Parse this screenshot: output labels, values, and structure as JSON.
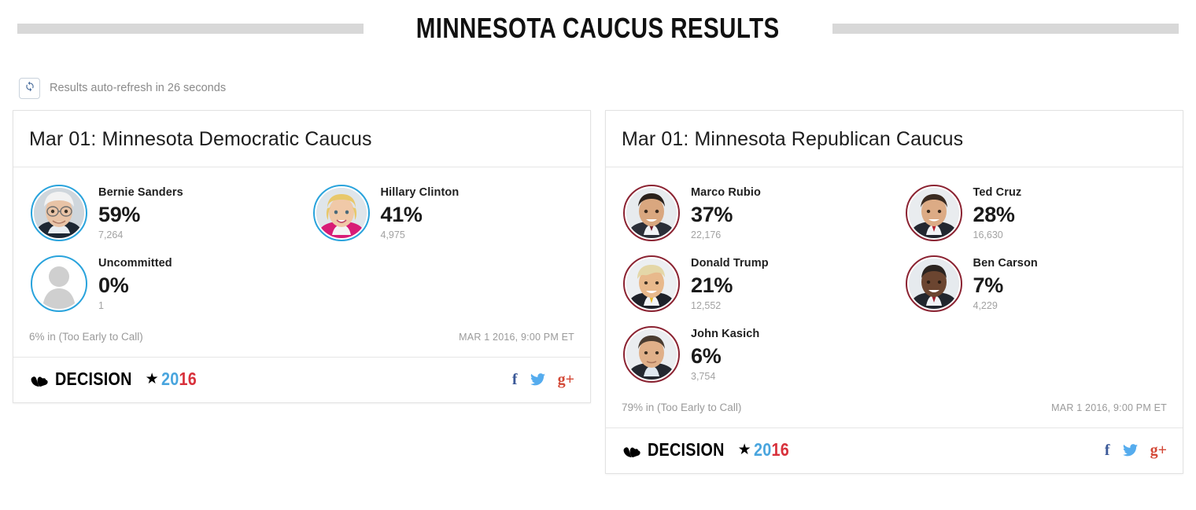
{
  "page": {
    "title": "MINNESOTA CAUCUS RESULTS"
  },
  "refresh": {
    "icon": "refresh-icon",
    "note": "Results auto-refresh in 26 seconds"
  },
  "colors": {
    "democratic_ring": "#29a3dc",
    "republican_ring": "#8b2332",
    "logo_blue": "#49a5de",
    "logo_red": "#d8313b",
    "facebook": "#3b5998",
    "twitter": "#55acee",
    "googleplus": "#d34836"
  },
  "logo": {
    "word": "DECISION",
    "star": "★",
    "year_blue": "20",
    "year_red": "16"
  },
  "socials": [
    {
      "name": "facebook-icon",
      "label": "f"
    },
    {
      "name": "twitter-icon",
      "label": ""
    },
    {
      "name": "googleplus-icon",
      "label": "g+"
    }
  ],
  "cards": [
    {
      "id": "democratic",
      "title": "Mar 01: Minnesota Democratic Caucus",
      "party": "dem",
      "status_left": "6% in (Too Early to Call)",
      "status_right": "MAR 1 2016, 9:00 PM ET",
      "candidates": [
        {
          "name": "Bernie Sanders",
          "pct": "59%",
          "votes": "7,264",
          "avatar": "bernie-sanders-photo"
        },
        {
          "name": "Hillary Clinton",
          "pct": "41%",
          "votes": "4,975",
          "avatar": "hillary-clinton-photo"
        },
        {
          "name": "Uncommitted",
          "pct": "0%",
          "votes": "1",
          "avatar": "placeholder-silhouette-photo"
        }
      ]
    },
    {
      "id": "republican",
      "title": "Mar 01: Minnesota Republican Caucus",
      "party": "rep",
      "status_left": "79% in (Too Early to Call)",
      "status_right": "MAR 1 2016, 9:00 PM ET",
      "candidates": [
        {
          "name": "Marco Rubio",
          "pct": "37%",
          "votes": "22,176",
          "avatar": "marco-rubio-photo"
        },
        {
          "name": "Ted Cruz",
          "pct": "28%",
          "votes": "16,630",
          "avatar": "ted-cruz-photo"
        },
        {
          "name": "Donald Trump",
          "pct": "21%",
          "votes": "12,552",
          "avatar": "donald-trump-photo"
        },
        {
          "name": "Ben Carson",
          "pct": "7%",
          "votes": "4,229",
          "avatar": "ben-carson-photo"
        },
        {
          "name": "John Kasich",
          "pct": "6%",
          "votes": "3,754",
          "avatar": "john-kasich-photo"
        }
      ]
    }
  ]
}
